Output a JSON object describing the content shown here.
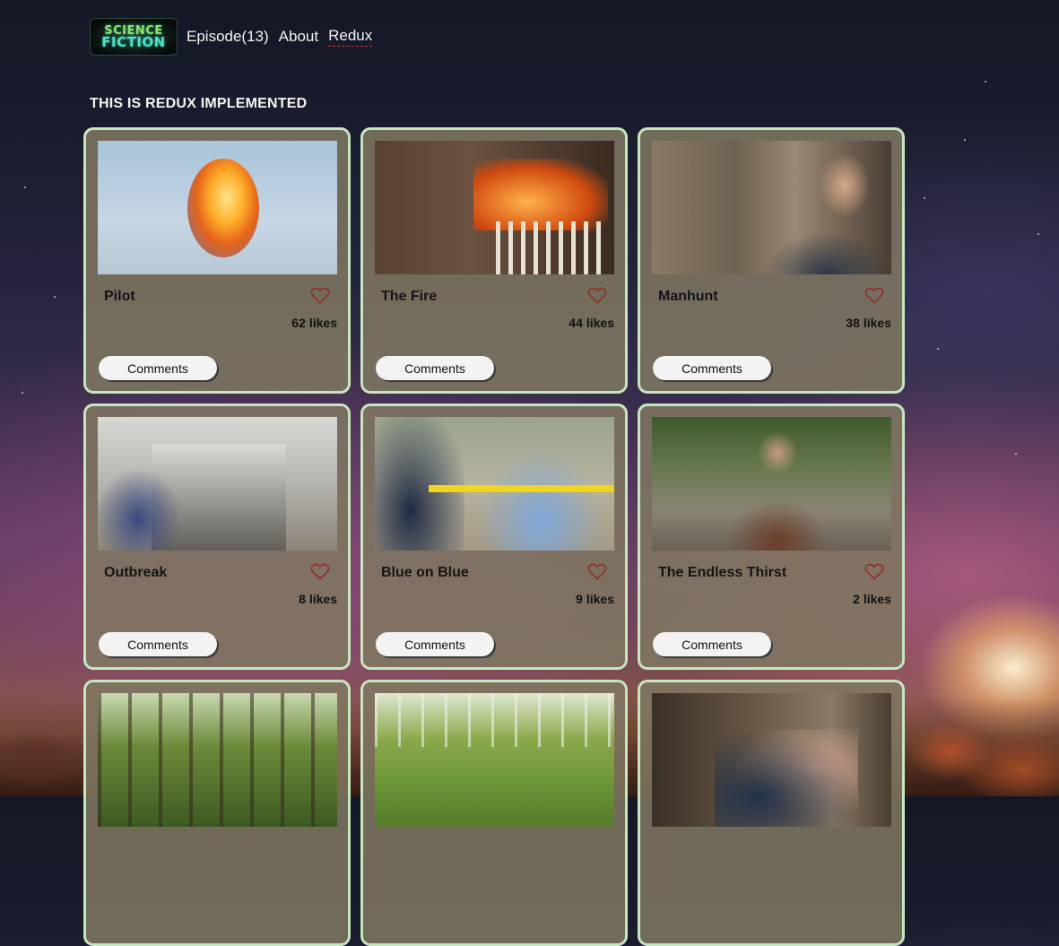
{
  "brand": {
    "logo_line1": "SCIENCE",
    "logo_line2": "FICTION"
  },
  "nav": [
    {
      "label": "Episode(13)"
    },
    {
      "label": "About"
    },
    {
      "label": "Redux",
      "active": true
    }
  ],
  "page_title": "THIS IS REDUX IMPLEMENTED",
  "colors": {
    "card_border": "#c7e5bf",
    "card_background": "#807862",
    "nav_active_underline": "#c0392b"
  },
  "episodes": [
    {
      "title": "Pilot",
      "likes": "62",
      "likes_unit": "likes",
      "comments_label": "Comments",
      "icon": "heart-outline-icon"
    },
    {
      "title": "The Fire",
      "likes": "44",
      "likes_unit": "likes",
      "comments_label": "Comments",
      "icon": "heart-outline-icon"
    },
    {
      "title": "Manhunt",
      "likes": "38",
      "likes_unit": "likes",
      "comments_label": "Comments",
      "icon": "heart-outline-icon"
    },
    {
      "title": "Outbreak",
      "likes": "8",
      "likes_unit": "likes",
      "comments_label": "Comments",
      "icon": "heart-outline-icon"
    },
    {
      "title": "Blue on Blue",
      "likes": "9",
      "likes_unit": "likes",
      "comments_label": "Comments",
      "icon": "heart-outline-icon"
    },
    {
      "title": "The Endless Thirst",
      "likes": "2",
      "likes_unit": "likes",
      "comments_label": "Comments",
      "icon": "heart-outline-icon"
    },
    {
      "title": "",
      "likes": "",
      "likes_unit": "",
      "comments_label": ""
    },
    {
      "title": "",
      "likes": "",
      "likes_unit": "",
      "comments_label": ""
    },
    {
      "title": "",
      "likes": "",
      "likes_unit": "",
      "comments_label": ""
    }
  ]
}
